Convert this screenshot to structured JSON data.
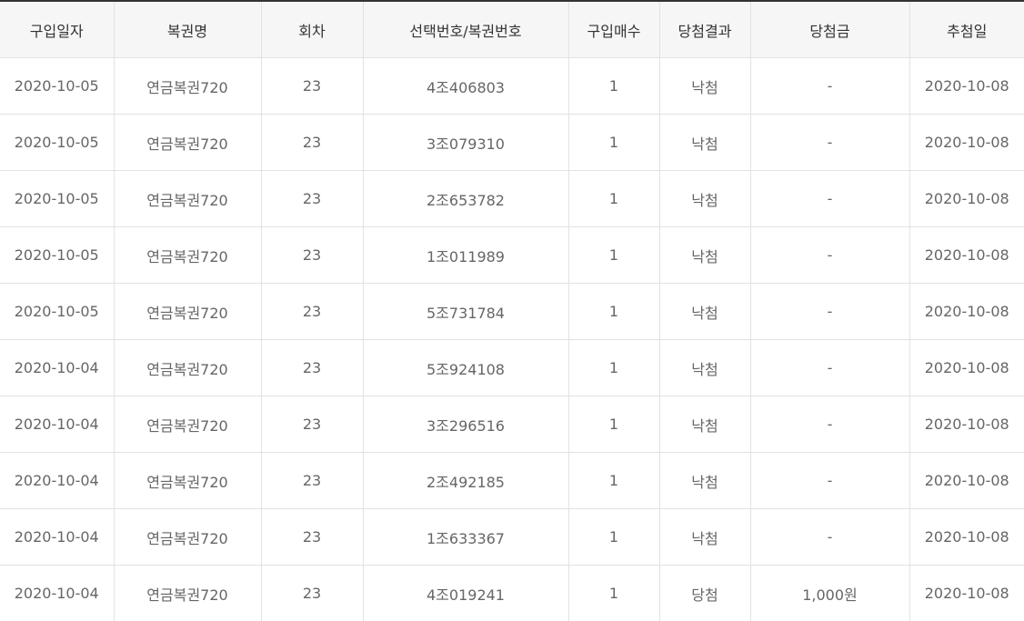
{
  "table": {
    "headers": [
      "구입일자",
      "복권명",
      "회차",
      "선택번호/복권번호",
      "구입매수",
      "당첨결과",
      "당첨금",
      "추첨일"
    ],
    "rows": [
      [
        "2020-10-05",
        "연금복권720",
        "23",
        "4조406803",
        "1",
        "낙첨",
        "-",
        "2020-10-08"
      ],
      [
        "2020-10-05",
        "연금복권720",
        "23",
        "3조079310",
        "1",
        "낙첨",
        "-",
        "2020-10-08"
      ],
      [
        "2020-10-05",
        "연금복권720",
        "23",
        "2조653782",
        "1",
        "낙첨",
        "-",
        "2020-10-08"
      ],
      [
        "2020-10-05",
        "연금복권720",
        "23",
        "1조011989",
        "1",
        "낙첨",
        "-",
        "2020-10-08"
      ],
      [
        "2020-10-05",
        "연금복권720",
        "23",
        "5조731784",
        "1",
        "낙첨",
        "-",
        "2020-10-08"
      ],
      [
        "2020-10-04",
        "연금복권720",
        "23",
        "5조924108",
        "1",
        "낙첨",
        "-",
        "2020-10-08"
      ],
      [
        "2020-10-04",
        "연금복권720",
        "23",
        "3조296516",
        "1",
        "낙첨",
        "-",
        "2020-10-08"
      ],
      [
        "2020-10-04",
        "연금복권720",
        "23",
        "2조492185",
        "1",
        "낙첨",
        "-",
        "2020-10-08"
      ],
      [
        "2020-10-04",
        "연금복권720",
        "23",
        "1조633367",
        "1",
        "낙첨",
        "-",
        "2020-10-08"
      ],
      [
        "2020-10-04",
        "연금복권720",
        "23",
        "4조019241",
        "1",
        "당첨",
        "1,000원",
        "2020-10-08"
      ]
    ]
  }
}
